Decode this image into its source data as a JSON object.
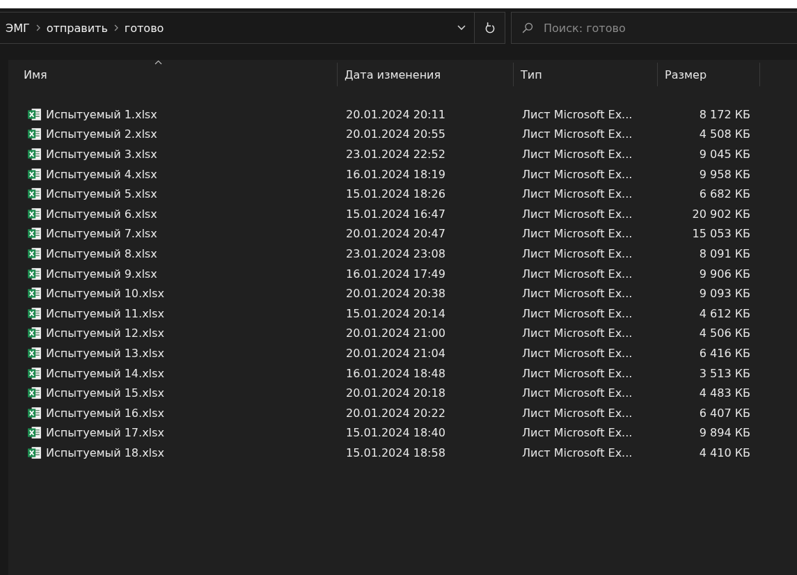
{
  "address_bar": {
    "path": [
      "ЭМГ",
      "отправить",
      "готово"
    ]
  },
  "search": {
    "placeholder": "Поиск: готово"
  },
  "table": {
    "columns": [
      "Имя",
      "Дата изменения",
      "Тип",
      "Размер"
    ],
    "rows": [
      {
        "name": "Испытуемый 1.xlsx",
        "date": "20.01.2024 20:11",
        "type": "Лист Microsoft Ex...",
        "size": "8 172 КБ"
      },
      {
        "name": "Испытуемый 2.xlsx",
        "date": "20.01.2024 20:55",
        "type": "Лист Microsoft Ex...",
        "size": "4 508 КБ"
      },
      {
        "name": "Испытуемый 3.xlsx",
        "date": "23.01.2024 22:52",
        "type": "Лист Microsoft Ex...",
        "size": "9 045 КБ"
      },
      {
        "name": "Испытуемый 4.xlsx",
        "date": "16.01.2024 18:19",
        "type": "Лист Microsoft Ex...",
        "size": "9 958 КБ"
      },
      {
        "name": "Испытуемый 5.xlsx",
        "date": "15.01.2024 18:26",
        "type": "Лист Microsoft Ex...",
        "size": "6 682 КБ"
      },
      {
        "name": "Испытуемый 6.xlsx",
        "date": "15.01.2024 16:47",
        "type": "Лист Microsoft Ex...",
        "size": "20 902 КБ"
      },
      {
        "name": "Испытуемый 7.xlsx",
        "date": "20.01.2024 20:47",
        "type": "Лист Microsoft Ex...",
        "size": "15 053 КБ"
      },
      {
        "name": "Испытуемый 8.xlsx",
        "date": "23.01.2024 23:08",
        "type": "Лист Microsoft Ex...",
        "size": "8 091 КБ"
      },
      {
        "name": "Испытуемый 9.xlsx",
        "date": "16.01.2024 17:49",
        "type": "Лист Microsoft Ex...",
        "size": "9 906 КБ"
      },
      {
        "name": "Испытуемый 10.xlsx",
        "date": "20.01.2024 20:38",
        "type": "Лист Microsoft Ex...",
        "size": "9 093 КБ"
      },
      {
        "name": "Испытуемый 11.xlsx",
        "date": "15.01.2024 20:14",
        "type": "Лист Microsoft Ex...",
        "size": "4 612 КБ"
      },
      {
        "name": "Испытуемый 12.xlsx",
        "date": "20.01.2024 21:00",
        "type": "Лист Microsoft Ex...",
        "size": "4 506 КБ"
      },
      {
        "name": "Испытуемый 13.xlsx",
        "date": "20.01.2024 21:04",
        "type": "Лист Microsoft Ex...",
        "size": "6 416 КБ"
      },
      {
        "name": "Испытуемый 14.xlsx",
        "date": "16.01.2024 18:48",
        "type": "Лист Microsoft Ex...",
        "size": "3 513 КБ"
      },
      {
        "name": "Испытуемый 15.xlsx",
        "date": "20.01.2024 20:18",
        "type": "Лист Microsoft Ex...",
        "size": "4 483 КБ"
      },
      {
        "name": "Испытуемый 16.xlsx",
        "date": "20.01.2024 20:22",
        "type": "Лист Microsoft Ex...",
        "size": "6 407 КБ"
      },
      {
        "name": "Испытуемый 17.xlsx",
        "date": "15.01.2024 18:40",
        "type": "Лист Microsoft Ex...",
        "size": "9 894 КБ"
      },
      {
        "name": "Испытуемый 18.xlsx",
        "date": "15.01.2024 18:58",
        "type": "Лист Microsoft Ex...",
        "size": "4 410 КБ"
      }
    ]
  }
}
